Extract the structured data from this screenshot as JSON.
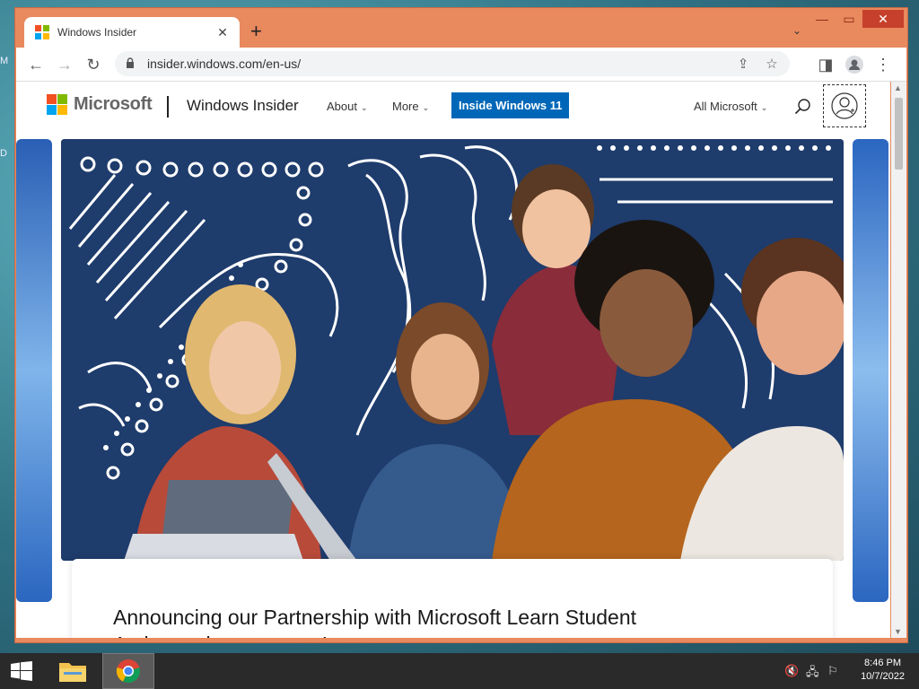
{
  "desktop": {
    "fragments": [
      "M",
      "D"
    ]
  },
  "browser": {
    "tab": {
      "title": "Windows Insider",
      "close": "✕"
    },
    "new_tab": "+",
    "tab_search": "⌄",
    "window_controls": {
      "minimize": "—",
      "maximize": "▭",
      "close": "✕"
    },
    "toolbar": {
      "back": "←",
      "forward": "→",
      "reload": "↻",
      "url": "insider.windows.com/en-us/",
      "share": "⇪",
      "bookmark": "☆",
      "side_panel": "◨",
      "menu": "⋮"
    },
    "colors": {
      "frame": "#e8895e",
      "close": "#c7402b"
    }
  },
  "site": {
    "brand": "Microsoft",
    "site_name": "Windows Insider",
    "nav": [
      {
        "label": "About"
      },
      {
        "label": "More"
      }
    ],
    "cta": "Inside Windows 11",
    "all_microsoft": "All Microsoft",
    "colors": {
      "cta": "#0067b8",
      "hero_bg": "#1e3c6c"
    },
    "hero": {
      "image": "students-laptop-illustration"
    },
    "card": {
      "title": "Announcing our Partnership with Microsoft Learn Student Ambassadors program!"
    }
  },
  "taskbar": {
    "apps": [
      {
        "name": "file-explorer"
      },
      {
        "name": "chrome",
        "active": true
      }
    ],
    "tray": [
      "🔇",
      "🖧",
      "⚐"
    ],
    "clock": {
      "time": "8:46 PM",
      "date": "10/7/2022"
    }
  }
}
